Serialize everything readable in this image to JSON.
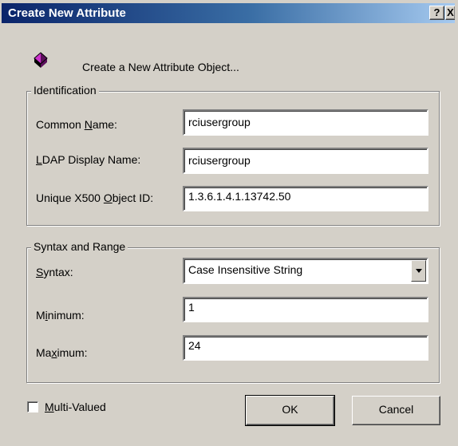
{
  "window": {
    "title": "Create New Attribute",
    "help_button": "?",
    "close_button": "X"
  },
  "header": {
    "text": "Create a New Attribute Object...",
    "icon": "attribute-diamond-icon"
  },
  "identification": {
    "legend": "Identification",
    "common_name": {
      "label_pre": "Common ",
      "label_key": "N",
      "label_post": "ame:",
      "value": "rciusergroup"
    },
    "ldap_display_name": {
      "label_key": "L",
      "label_post": "DAP Display Name:",
      "value": "rciusergroup"
    },
    "object_id": {
      "label_pre": "Unique X500 ",
      "label_key": "O",
      "label_post": "bject ID:",
      "value": "1.3.6.1.4.1.13742.50"
    }
  },
  "syntax_range": {
    "legend": "Syntax and Range",
    "syntax": {
      "label_key": "S",
      "label_post": "yntax:",
      "value": "Case Insensitive String"
    },
    "minimum": {
      "label_pre": "M",
      "label_key": "i",
      "label_post": "nimum:",
      "value": "1"
    },
    "maximum": {
      "label_pre": "Ma",
      "label_key": "x",
      "label_post": "imum:",
      "value": "24"
    }
  },
  "multi_valued": {
    "label_key": "M",
    "label_post": "ulti-Valued",
    "checked": false
  },
  "buttons": {
    "ok": "OK",
    "cancel": "Cancel"
  },
  "colors": {
    "title_start": "#0a246a",
    "title_end": "#a6caf0",
    "dialog_bg": "#d4d0c8",
    "icon": "#cc33cc"
  }
}
